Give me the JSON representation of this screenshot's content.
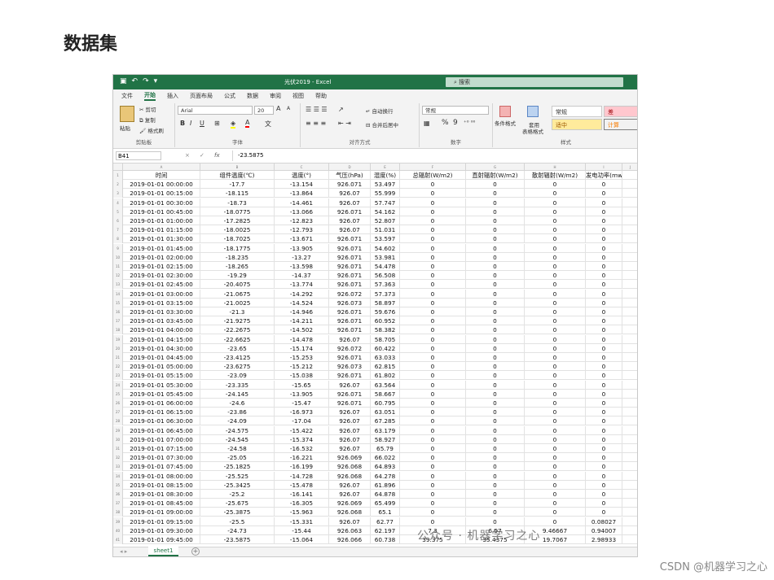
{
  "page": {
    "heading": "数据集"
  },
  "excel": {
    "title": "光伏2019 - Excel",
    "search_placeholder": "搜索",
    "tabs": [
      "文件",
      "开始",
      "插入",
      "页面布局",
      "公式",
      "数据",
      "审阅",
      "视图",
      "帮助"
    ],
    "active_tab": "开始",
    "ribbon": {
      "clipboard": {
        "paste": "粘贴",
        "cut": "剪切",
        "copy": "复制",
        "format_painter": "格式刷",
        "label": "剪贴板"
      },
      "font": {
        "name": "Arial",
        "size": "20",
        "grow": "A",
        "shrink": "A",
        "bold": "B",
        "italic": "I",
        "underline": "U",
        "label": "字体"
      },
      "alignment": {
        "wrap": "自动换行",
        "merge": "合并后居中",
        "label": "对齐方式"
      },
      "number": {
        "format": "常规",
        "percent": "%",
        "comma": "9",
        "label": "数字"
      },
      "styles": {
        "conditional": "条件格式",
        "table_line1": "套用",
        "table_line2": "表格格式",
        "normal": "常规",
        "bad": "差",
        "neutral": "适中",
        "calc": "计算",
        "label": "样式"
      }
    },
    "formula_bar": {
      "name_box": "B41",
      "cancel": "×",
      "enter": "✓",
      "fx": "fx",
      "value": "-23.5875"
    },
    "column_letters": [
      "A",
      "B",
      "C",
      "D",
      "E",
      "F",
      "G",
      "H",
      "I",
      "J"
    ],
    "headers": [
      "时间",
      "组件温度(℃)",
      "温度(°)",
      "气压(hPa)",
      "湿度(%)",
      "总辐射(W/m2)",
      "直射辐射(W/m2)",
      "散射辐射(W/m2)",
      "发电功率(mw)"
    ],
    "rows": [
      [
        "2019-01-01 00:00:00",
        "-17.7",
        "-13.154",
        "926.071",
        "53.497",
        "0",
        "0",
        "0",
        "0"
      ],
      [
        "2019-01-01 00:15:00",
        "-18.115",
        "-13.864",
        "926.07",
        "55.999",
        "0",
        "0",
        "0",
        "0"
      ],
      [
        "2019-01-01 00:30:00",
        "-18.73",
        "-14.461",
        "926.07",
        "57.747",
        "0",
        "0",
        "0",
        "0"
      ],
      [
        "2019-01-01 00:45:00",
        "-18.0775",
        "-13.066",
        "926.071",
        "54.162",
        "0",
        "0",
        "0",
        "0"
      ],
      [
        "2019-01-01 01:00:00",
        "-17.2825",
        "-12.823",
        "926.07",
        "52.807",
        "0",
        "0",
        "0",
        "0"
      ],
      [
        "2019-01-01 01:15:00",
        "-18.0025",
        "-12.793",
        "926.07",
        "51.031",
        "0",
        "0",
        "0",
        "0"
      ],
      [
        "2019-01-01 01:30:00",
        "-18.7025",
        "-13.671",
        "926.071",
        "53.597",
        "0",
        "0",
        "0",
        "0"
      ],
      [
        "2019-01-01 01:45:00",
        "-18.1775",
        "-13.905",
        "926.071",
        "54.602",
        "0",
        "0",
        "0",
        "0"
      ],
      [
        "2019-01-01 02:00:00",
        "-18.235",
        "-13.27",
        "926.071",
        "53.981",
        "0",
        "0",
        "0",
        "0"
      ],
      [
        "2019-01-01 02:15:00",
        "-18.265",
        "-13.598",
        "926.071",
        "54.478",
        "0",
        "0",
        "0",
        "0"
      ],
      [
        "2019-01-01 02:30:00",
        "-19.29",
        "-14.37",
        "926.071",
        "56.508",
        "0",
        "0",
        "0",
        "0"
      ],
      [
        "2019-01-01 02:45:00",
        "-20.4075",
        "-13.774",
        "926.071",
        "57.363",
        "0",
        "0",
        "0",
        "0"
      ],
      [
        "2019-01-01 03:00:00",
        "-21.0675",
        "-14.292",
        "926.072",
        "57.373",
        "0",
        "0",
        "0",
        "0"
      ],
      [
        "2019-01-01 03:15:00",
        "-21.0025",
        "-14.524",
        "926.073",
        "58.897",
        "0",
        "0",
        "0",
        "0"
      ],
      [
        "2019-01-01 03:30:00",
        "-21.3",
        "-14.946",
        "926.071",
        "59.676",
        "0",
        "0",
        "0",
        "0"
      ],
      [
        "2019-01-01 03:45:00",
        "-21.9275",
        "-14.211",
        "926.071",
        "60.952",
        "0",
        "0",
        "0",
        "0"
      ],
      [
        "2019-01-01 04:00:00",
        "-22.2675",
        "-14.502",
        "926.071",
        "58.382",
        "0",
        "0",
        "0",
        "0"
      ],
      [
        "2019-01-01 04:15:00",
        "-22.6625",
        "-14.478",
        "926.07",
        "58.705",
        "0",
        "0",
        "0",
        "0"
      ],
      [
        "2019-01-01 04:30:00",
        "-23.65",
        "-15.174",
        "926.072",
        "60.422",
        "0",
        "0",
        "0",
        "0"
      ],
      [
        "2019-01-01 04:45:00",
        "-23.4125",
        "-15.253",
        "926.071",
        "63.033",
        "0",
        "0",
        "0",
        "0"
      ],
      [
        "2019-01-01 05:00:00",
        "-23.6275",
        "-15.212",
        "926.073",
        "62.815",
        "0",
        "0",
        "0",
        "0"
      ],
      [
        "2019-01-01 05:15:00",
        "-23.09",
        "-15.038",
        "926.071",
        "61.802",
        "0",
        "0",
        "0",
        "0"
      ],
      [
        "2019-01-01 05:30:00",
        "-23.335",
        "-15.65",
        "926.07",
        "63.564",
        "0",
        "0",
        "0",
        "0"
      ],
      [
        "2019-01-01 05:45:00",
        "-24.145",
        "-13.905",
        "926.071",
        "58.667",
        "0",
        "0",
        "0",
        "0"
      ],
      [
        "2019-01-01 06:00:00",
        "-24.6",
        "-15.47",
        "926.071",
        "60.795",
        "0",
        "0",
        "0",
        "0"
      ],
      [
        "2019-01-01 06:15:00",
        "-23.86",
        "-16.973",
        "926.07",
        "63.051",
        "0",
        "0",
        "0",
        "0"
      ],
      [
        "2019-01-01 06:30:00",
        "-24.09",
        "-17.04",
        "926.07",
        "67.285",
        "0",
        "0",
        "0",
        "0"
      ],
      [
        "2019-01-01 06:45:00",
        "-24.575",
        "-15.422",
        "926.07",
        "63.179",
        "0",
        "0",
        "0",
        "0"
      ],
      [
        "2019-01-01 07:00:00",
        "-24.545",
        "-15.374",
        "926.07",
        "58.927",
        "0",
        "0",
        "0",
        "0"
      ],
      [
        "2019-01-01 07:15:00",
        "-24.58",
        "-16.532",
        "926.07",
        "65.79",
        "0",
        "0",
        "0",
        "0"
      ],
      [
        "2019-01-01 07:30:00",
        "-25.05",
        "-16.221",
        "926.069",
        "66.022",
        "0",
        "0",
        "0",
        "0"
      ],
      [
        "2019-01-01 07:45:00",
        "-25.1825",
        "-16.199",
        "926.068",
        "64.893",
        "0",
        "0",
        "0",
        "0"
      ],
      [
        "2019-01-01 08:00:00",
        "-25.525",
        "-14.728",
        "926.068",
        "64.278",
        "0",
        "0",
        "0",
        "0"
      ],
      [
        "2019-01-01 08:15:00",
        "-25.3425",
        "-15.478",
        "926.07",
        "61.896",
        "0",
        "0",
        "0",
        "0"
      ],
      [
        "2019-01-01 08:30:00",
        "-25.2",
        "-16.141",
        "926.07",
        "64.878",
        "0",
        "0",
        "0",
        "0"
      ],
      [
        "2019-01-01 08:45:00",
        "-25.675",
        "-16.305",
        "926.069",
        "65.499",
        "0",
        "0",
        "0",
        "0"
      ],
      [
        "2019-01-01 09:00:00",
        "-25.3875",
        "-15.963",
        "926.068",
        "65.1",
        "0",
        "0",
        "0",
        "0"
      ],
      [
        "2019-01-01 09:15:00",
        "-25.5",
        "-15.331",
        "926.07",
        "62.77",
        "0",
        "0",
        "0",
        "0.08027"
      ],
      [
        "2019-01-01 09:30:00",
        "-24.73",
        "-15.44",
        "926.063",
        "62.197",
        "7.3",
        "6.57",
        "9.46667",
        "0.94007"
      ],
      [
        "2019-01-01 09:45:00",
        "-23.5875",
        "-15.064",
        "926.066",
        "60.738",
        "39.375",
        "35.4375",
        "19.7067",
        "2.98933"
      ]
    ],
    "sheet_tab": "sheet1",
    "add_sheet": "+"
  },
  "watermark": "公众号 · 机器学习之心",
  "csdn_mark": "CSDN @机器学习之心"
}
